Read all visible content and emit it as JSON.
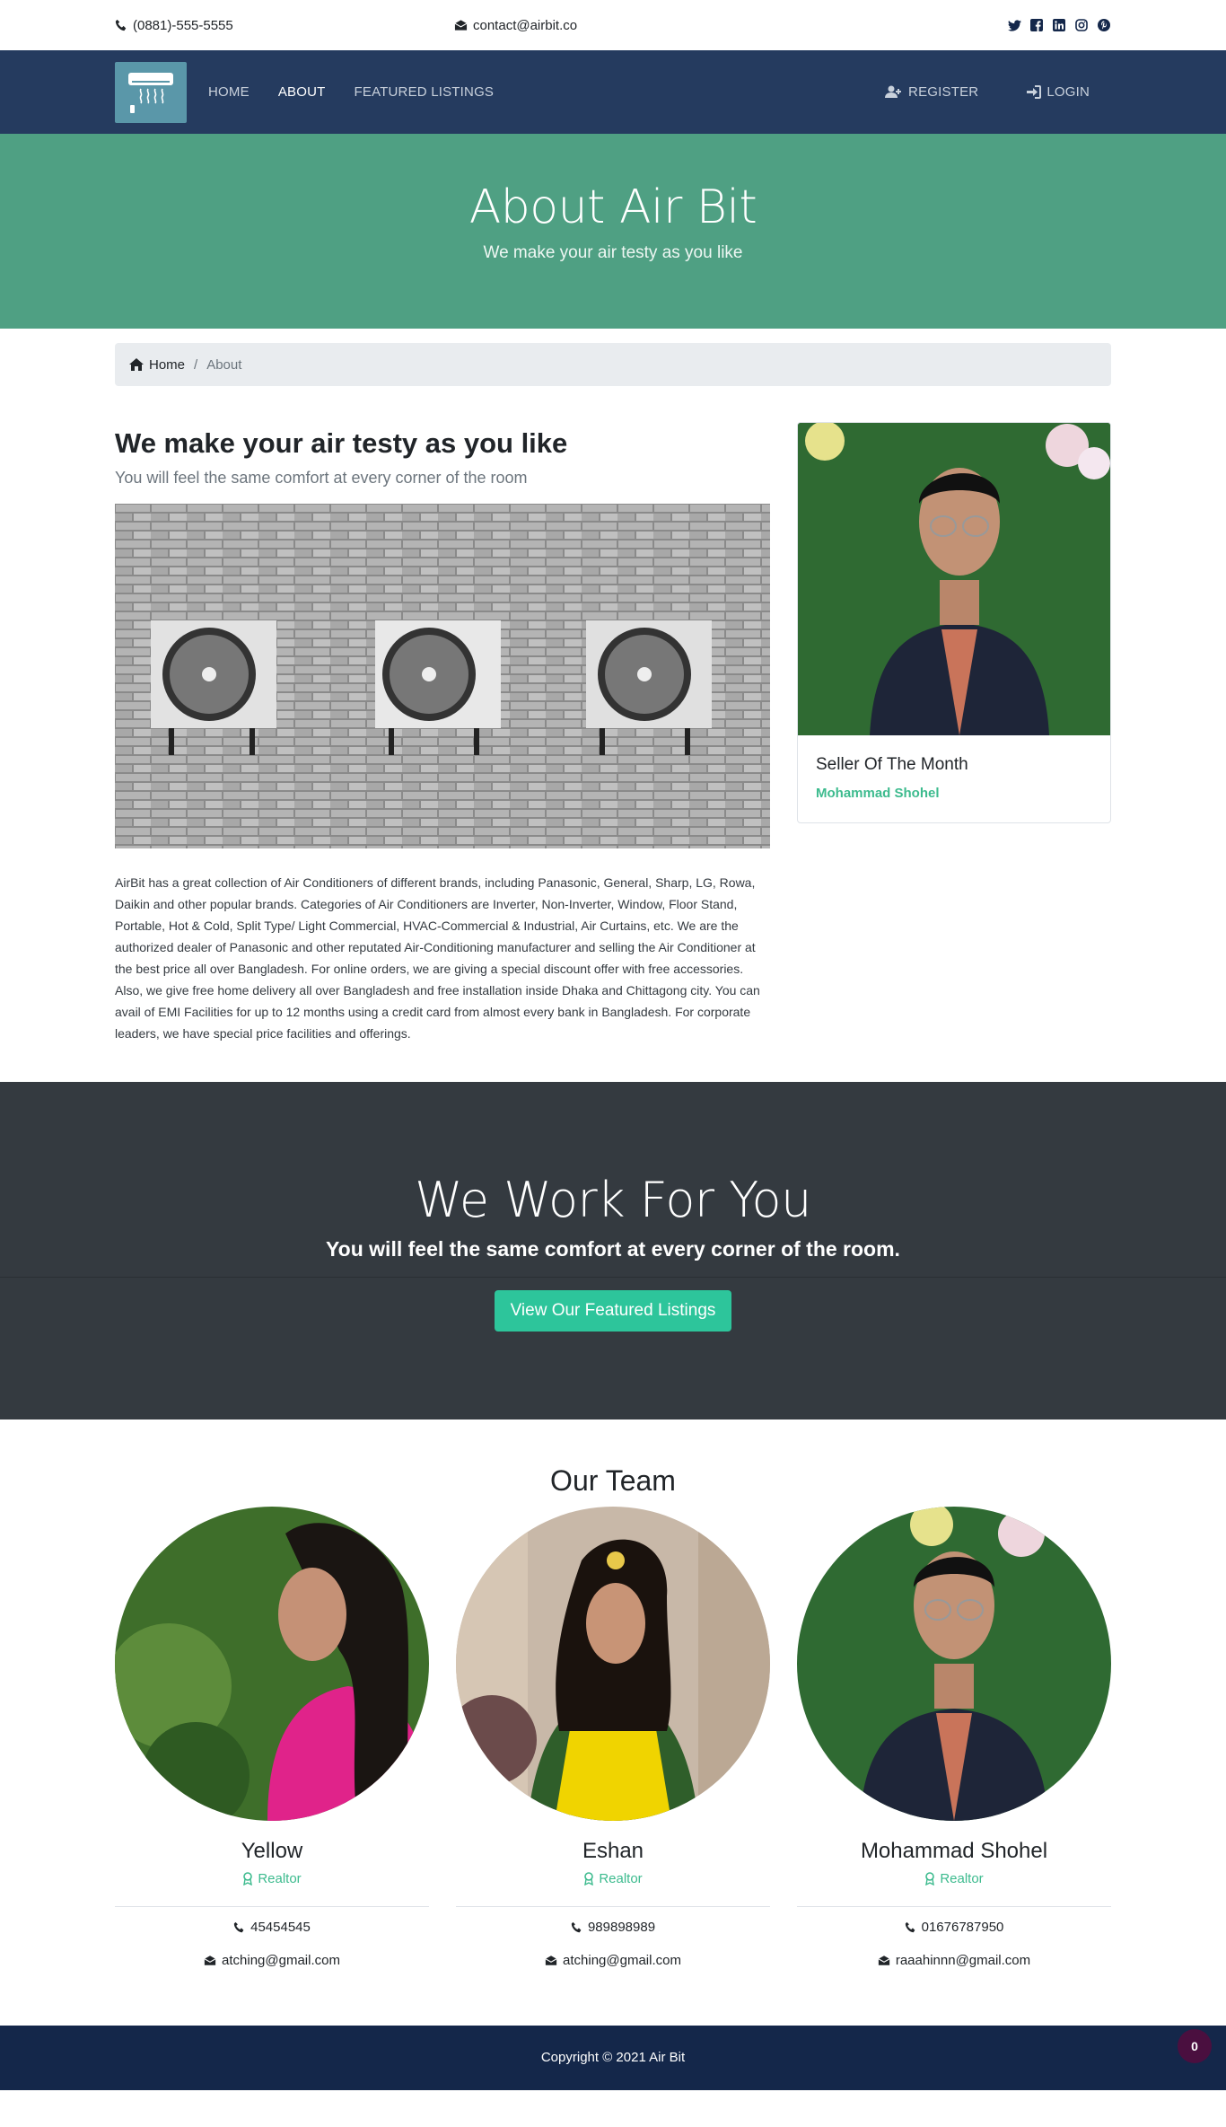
{
  "topbar": {
    "phone": "(0881)-555-5555",
    "email": "contact@airbit.co",
    "social": [
      "twitter-icon",
      "facebook-icon",
      "linkedin-icon",
      "instagram-icon",
      "pinterest-icon"
    ]
  },
  "nav": {
    "links": [
      "Home",
      "About",
      "Featured Listings"
    ],
    "active": "About",
    "register": "Register",
    "login": "Login"
  },
  "hero": {
    "title": "About Air Bit",
    "subtitle": "We make your air testy as you like"
  },
  "breadcrumb": {
    "home": "Home",
    "current": "About"
  },
  "about": {
    "heading": "We make your air testy as you like",
    "lead": "You will feel the same comfort at every corner of the room",
    "description": "AirBit has a great collection of Air Conditioners of different brands, including Panasonic, General, Sharp, LG, Rowa, Daikin and other popular brands. Categories of Air Conditioners are Inverter, Non-Inverter, Window, Floor Stand, Portable, Hot & Cold, Split Type/ Light Commercial, HVAC-Commercial & Industrial, Air Curtains, etc. We are the authorized dealer of Panasonic and other reputated Air-Conditioning manufacturer and selling the Air Conditioner at the best price all over Bangladesh. For online orders, we are giving a special discount offer with free accessories. Also, we give free home delivery all over Bangladesh and free installation inside Dhaka and Chittagong city. You can avail of EMI Facilities for up to 12 months using a credit card from almost every bank in Bangladesh. For corporate leaders, we have special price facilities and offerings."
  },
  "seller": {
    "title": "Seller Of The Month",
    "name": "Mohammad Shohel"
  },
  "work": {
    "title": "We Work For You",
    "subtitle": "You will feel the same comfort at every corner of the room.",
    "button": "View Our Featured Listings"
  },
  "team": {
    "title": "Our Team",
    "members": [
      {
        "name": "Yellow",
        "role": "Realtor",
        "phone": "45454545",
        "email": "atching@gmail.com"
      },
      {
        "name": "Eshan",
        "role": "Realtor",
        "phone": "989898989",
        "email": "atching@gmail.com"
      },
      {
        "name": "Mohammad Shohel",
        "role": "Realtor",
        "phone": "01676787950",
        "email": "raaahinnn@gmail.com"
      }
    ]
  },
  "footer": {
    "copyright": "Copyright © 2021 Air Bit",
    "badge": "0"
  },
  "colors": {
    "nav": "#253b5f",
    "hero": "#4fa083",
    "accent": "#2dc59b",
    "dark": "#343a40",
    "footer": "#14274a"
  }
}
